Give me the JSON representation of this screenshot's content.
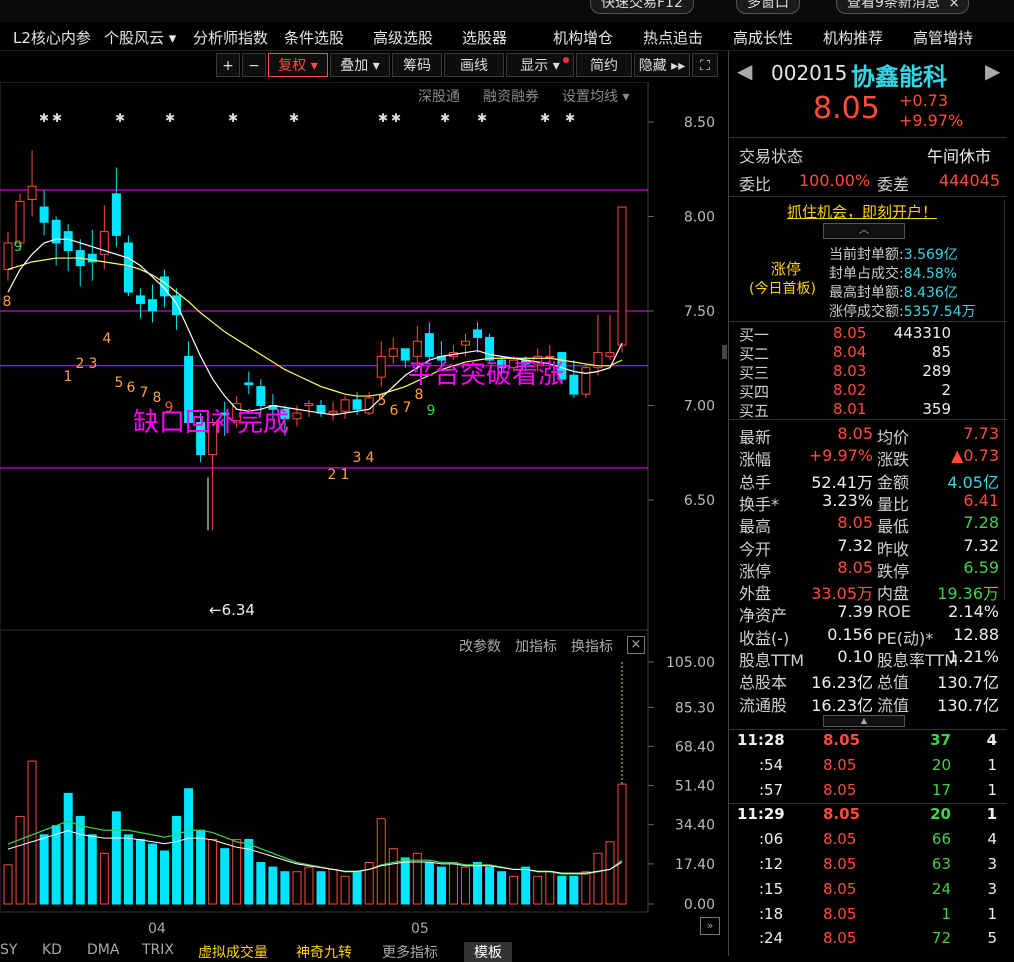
{
  "top": {
    "pill1": "快速交易F12",
    "pill2": "多窗口",
    "pill3": "查看9条新消息",
    "close": "×"
  },
  "nav": [
    "L2核心内参",
    "个股风云 ▾",
    "分析师指数",
    "条件选股",
    "高级选股",
    "选股器",
    "机构增仓",
    "热点追击",
    "高成长性",
    "机构推荐",
    "高管增持"
  ],
  "toolbar": {
    "plus": "+",
    "minus": "−",
    "fuquan": "复权 ▾",
    "diejia": "叠加 ▾",
    "chouma": "筹码",
    "huaxian": "画线",
    "xianshi": "显示 ▾",
    "jianyue": "简约",
    "yincang": "隐藏 ▸▸",
    "expand": "⛶"
  },
  "chart": {
    "sublinks": [
      "深股通",
      "融资融券",
      "设置均线 ▾"
    ],
    "price_ticks": [
      "8.50",
      "8.00",
      "7.50",
      "7.00",
      "6.50"
    ],
    "annotation_gap": "缺口回补完成",
    "annotation_breakout": "平台突破看涨",
    "low_label": "←6.34",
    "vol_links": [
      "改参数",
      "加指标",
      "换指标"
    ],
    "vol_close": "×",
    "vol_ticks": [
      "105.00",
      "85.30",
      "68.40",
      "51.40",
      "34.40",
      "17.40",
      "0.00"
    ],
    "date_labels": [
      "04",
      "05"
    ],
    "seq_labels": [
      {
        "t": "9",
        "c": "#3fd24a"
      },
      {
        "t": "8",
        "c": "#ffa040"
      },
      {
        "t": "1",
        "c": "#ffa040"
      },
      {
        "t": "2",
        "c": "#ffa040"
      },
      {
        "t": "3",
        "c": "#ffa040"
      },
      {
        "t": "4",
        "c": "#ffa040"
      },
      {
        "t": "5",
        "c": "#ffa040"
      },
      {
        "t": "6",
        "c": "#ffa040"
      },
      {
        "t": "7",
        "c": "#ffa040"
      },
      {
        "t": "8",
        "c": "#ffa040"
      },
      {
        "t": "9",
        "c": "#ff4a3d"
      },
      {
        "t": "1",
        "c": "#ffa040"
      },
      {
        "t": "2",
        "c": "#ffa040"
      },
      {
        "t": "3",
        "c": "#ffa040"
      },
      {
        "t": "4",
        "c": "#ffa040"
      },
      {
        "t": "5",
        "c": "#ffa040"
      },
      {
        "t": "6",
        "c": "#ffa040"
      },
      {
        "t": "7",
        "c": "#ffa040"
      },
      {
        "t": "8",
        "c": "#ffa040"
      },
      {
        "t": "9",
        "c": "#3fd24a"
      }
    ]
  },
  "bottom_tabs": [
    "SY",
    "KD",
    "DMA",
    "TRIX",
    "虚拟成交量",
    "神奇九转",
    "更多指标",
    "模板"
  ],
  "stock": {
    "code": "002015",
    "name": "协鑫能科",
    "price": "8.05",
    "change": "+0.73",
    "change_pct": "+9.97%",
    "status_label": "交易状态",
    "status_value": "午间休市",
    "weibi_label": "委比",
    "weibi_value": "100.00%",
    "weicha_label": "委差",
    "weicha_value": "444045",
    "promo": "抓住机会，即刻开户！",
    "limit_title": "涨停",
    "limit_sub": "(今日首板)",
    "limit_rows": [
      {
        "k": "当前封单额:",
        "v": "3.569亿"
      },
      {
        "k": "封单占成交:",
        "v": "84.58%"
      },
      {
        "k": "最高封单额:",
        "v": "8.436亿"
      },
      {
        "k": "涨停成交额:",
        "v": "5357.54万"
      }
    ],
    "bids": [
      {
        "k": "买一",
        "p": "8.05",
        "v": "443310"
      },
      {
        "k": "买二",
        "p": "8.04",
        "v": "85"
      },
      {
        "k": "买三",
        "p": "8.03",
        "v": "289"
      },
      {
        "k": "买四",
        "p": "8.02",
        "v": "2"
      },
      {
        "k": "买五",
        "p": "8.01",
        "v": "359"
      }
    ],
    "stats": [
      {
        "k1": "最新",
        "v1": "8.05",
        "c1": "red",
        "k2": "均价",
        "v2": "7.73",
        "c2": "red"
      },
      {
        "k1": "涨幅",
        "v1": "+9.97%",
        "c1": "red",
        "k2": "涨跌",
        "v2": "▲0.73",
        "c2": "red"
      },
      {
        "k1": "总手",
        "v1": "52.41万",
        "c1": "white",
        "k2": "金额",
        "v2": "4.05亿",
        "c2": "cyan"
      },
      {
        "k1": "换手*",
        "v1": "3.23%",
        "c1": "white",
        "k2": "量比",
        "v2": "6.41",
        "c2": "red"
      },
      {
        "k1": "最高",
        "v1": "8.05",
        "c1": "red",
        "k2": "最低",
        "v2": "7.28",
        "c2": "green"
      },
      {
        "k1": "今开",
        "v1": "7.32",
        "c1": "white",
        "k2": "昨收",
        "v2": "7.32",
        "c2": "white"
      },
      {
        "k1": "涨停",
        "v1": "8.05",
        "c1": "red",
        "k2": "跌停",
        "v2": "6.59",
        "c2": "green"
      },
      {
        "k1": "外盘",
        "v1": "33.05万",
        "c1": "red",
        "k2": "内盘",
        "v2": "19.36万",
        "c2": "green"
      },
      {
        "k1": "净资产",
        "v1": "7.39",
        "c1": "white",
        "k2": "ROE",
        "v2": "2.14%",
        "c2": "white"
      },
      {
        "k1": "收益(-)",
        "v1": "0.156",
        "c1": "white",
        "k2": "PE(动)*",
        "v2": "12.88",
        "c2": "white"
      },
      {
        "k1": "股息TTM",
        "v1": "0.10",
        "c1": "white",
        "k2": "股息率TTM",
        "v2": "1.21%",
        "c2": "white"
      },
      {
        "k1": "总股本",
        "v1": "16.23亿",
        "c1": "white",
        "k2": "总值",
        "v2": "130.7亿",
        "c2": "white"
      },
      {
        "k1": "流通股",
        "v1": "16.23亿",
        "c1": "white",
        "k2": "流值",
        "v2": "130.7亿",
        "c2": "white"
      }
    ],
    "ticks": [
      {
        "t": "11:28",
        "p": "8.05",
        "v": "37",
        "n": "4"
      },
      {
        "t": ":54",
        "p": "8.05",
        "v": "20",
        "n": "1"
      },
      {
        "t": ":57",
        "p": "8.05",
        "v": "17",
        "n": "1"
      },
      {
        "t": "11:29",
        "p": "8.05",
        "v": "20",
        "n": "1"
      },
      {
        "t": ":06",
        "p": "8.05",
        "v": "66",
        "n": "4"
      },
      {
        "t": ":12",
        "p": "8.05",
        "v": "63",
        "n": "3"
      },
      {
        "t": ":15",
        "p": "8.05",
        "v": "24",
        "n": "3"
      },
      {
        "t": ":18",
        "p": "8.05",
        "v": "1",
        "n": "1"
      },
      {
        "t": ":24",
        "p": "8.05",
        "v": "72",
        "n": "5"
      }
    ]
  },
  "colors": {
    "up": "#ff4a3d",
    "down": "#00e5ff",
    "magenta": "#ff00ff",
    "ma5": "#ffffff",
    "ma10": "#ffff66"
  },
  "chart_data": {
    "type": "candlestick",
    "ylim": [
      6.3,
      8.65
    ],
    "horizontal_lines": [
      8.14,
      7.5,
      7.21,
      6.67
    ],
    "low_marker": 6.34,
    "candles": [
      [
        7.72,
        7.86,
        7.66,
        7.92
      ],
      [
        7.86,
        8.08,
        7.82,
        8.12
      ],
      [
        8.09,
        8.16,
        8.0,
        8.35
      ],
      [
        8.05,
        7.97,
        7.9,
        8.14
      ],
      [
        7.98,
        7.86,
        7.74,
        8.0
      ],
      [
        7.92,
        7.82,
        7.71,
        7.96
      ],
      [
        7.82,
        7.74,
        7.63,
        7.88
      ],
      [
        7.8,
        7.76,
        7.66,
        7.93
      ],
      [
        7.8,
        7.92,
        7.72,
        8.06
      ],
      [
        8.12,
        7.9,
        7.84,
        8.26
      ],
      [
        7.86,
        7.6,
        7.58,
        7.9
      ],
      [
        7.58,
        7.54,
        7.46,
        7.62
      ],
      [
        7.56,
        7.5,
        7.44,
        7.64
      ],
      [
        7.68,
        7.58,
        7.52,
        7.72
      ],
      [
        7.58,
        7.48,
        7.4,
        7.62
      ],
      [
        7.26,
        6.91,
        6.88,
        7.34
      ],
      [
        6.91,
        6.74,
        6.7,
        6.96
      ],
      [
        6.74,
        6.91,
        6.34,
        6.93
      ],
      [
        6.96,
        6.95,
        6.84,
        7.02
      ],
      [
        6.92,
        7.01,
        6.88,
        7.05
      ],
      [
        7.12,
        7.11,
        7.06,
        7.18
      ],
      [
        7.1,
        7.0,
        6.96,
        7.14
      ],
      [
        7.0,
        6.98,
        6.92,
        7.06
      ],
      [
        6.98,
        6.93,
        6.84,
        7.0
      ],
      [
        6.93,
        6.96,
        6.89,
        7.0
      ],
      [
        7.0,
        7.01,
        6.94,
        7.03
      ],
      [
        7.0,
        6.96,
        6.94,
        7.03
      ],
      [
        6.96,
        6.97,
        6.92,
        7.02
      ],
      [
        6.97,
        7.03,
        6.93,
        7.05
      ],
      [
        7.03,
        6.98,
        6.95,
        7.07
      ],
      [
        6.96,
        7.04,
        6.95,
        7.07
      ],
      [
        7.15,
        7.26,
        7.1,
        7.34
      ],
      [
        7.26,
        7.3,
        7.22,
        7.36
      ],
      [
        7.3,
        7.24,
        7.2,
        7.3
      ],
      [
        7.26,
        7.34,
        7.18,
        7.42
      ],
      [
        7.38,
        7.26,
        7.24,
        7.44
      ],
      [
        7.26,
        7.24,
        7.2,
        7.34
      ],
      [
        7.26,
        7.28,
        7.24,
        7.32
      ],
      [
        7.32,
        7.34,
        7.26,
        7.38
      ],
      [
        7.4,
        7.36,
        7.28,
        7.44
      ],
      [
        7.36,
        7.24,
        7.22,
        7.38
      ],
      [
        7.24,
        7.2,
        7.16,
        7.26
      ],
      [
        7.2,
        7.24,
        7.18,
        7.26
      ],
      [
        7.24,
        7.22,
        7.18,
        7.26
      ],
      [
        7.22,
        7.26,
        7.18,
        7.3
      ],
      [
        7.26,
        7.26,
        7.22,
        7.32
      ],
      [
        7.28,
        7.14,
        7.12,
        7.28
      ],
      [
        7.16,
        7.06,
        7.04,
        7.24
      ],
      [
        7.06,
        7.2,
        7.04,
        7.22
      ],
      [
        7.2,
        7.28,
        7.16,
        7.48
      ],
      [
        7.26,
        7.28,
        7.24,
        7.48
      ],
      [
        7.32,
        8.05,
        7.28,
        8.05
      ]
    ],
    "ma5": [
      7.6,
      7.72,
      7.8,
      7.86,
      7.88,
      7.88,
      7.86,
      7.84,
      7.82,
      7.8,
      7.78,
      7.74,
      7.68,
      7.62,
      7.54,
      7.4,
      7.26,
      7.14,
      7.05,
      6.98,
      6.97,
      6.98,
      7.0,
      6.99,
      6.98,
      6.97,
      6.96,
      6.95,
      6.96,
      6.97,
      6.98,
      7.04,
      7.1,
      7.16,
      7.2,
      7.24,
      7.26,
      7.27,
      7.28,
      7.29,
      7.27,
      7.26,
      7.25,
      7.24,
      7.23,
      7.22,
      7.2,
      7.18,
      7.17,
      7.18,
      7.2,
      7.33
    ],
    "ma10": [
      7.72,
      7.74,
      7.76,
      7.77,
      7.78,
      7.78,
      7.78,
      7.77,
      7.76,
      7.75,
      7.74,
      7.72,
      7.69,
      7.65,
      7.6,
      7.55,
      7.49,
      7.44,
      7.39,
      7.35,
      7.31,
      7.27,
      7.23,
      7.19,
      7.16,
      7.13,
      7.1,
      7.08,
      7.06,
      7.05,
      7.05,
      7.06,
      7.08,
      7.1,
      7.13,
      7.16,
      7.19,
      7.21,
      7.23,
      7.24,
      7.25,
      7.25,
      7.25,
      7.25,
      7.25,
      7.25,
      7.24,
      7.23,
      7.22,
      7.21,
      7.21,
      7.24
    ],
    "volume_ylim": [
      0,
      105
    ],
    "volume": [
      17,
      38,
      62,
      30,
      34,
      48,
      38,
      30,
      22,
      40,
      30,
      28,
      26,
      23,
      38,
      50,
      32,
      28,
      24,
      28,
      28,
      18,
      16,
      14,
      14,
      16,
      14,
      15,
      12,
      14,
      18,
      37,
      24,
      20,
      22,
      18,
      16,
      18,
      16,
      18,
      16,
      14,
      12,
      16,
      12,
      14,
      12,
      12,
      14,
      22,
      27,
      52
    ],
    "volume_ma": [
      26,
      28,
      30,
      32,
      34,
      36,
      34,
      33,
      32,
      32,
      32,
      31,
      30,
      29,
      30,
      32,
      32,
      31,
      29,
      27,
      26,
      24,
      22,
      20,
      18,
      17,
      16,
      15,
      14,
      14,
      15,
      17,
      18,
      19,
      19,
      19,
      18,
      18,
      17,
      17,
      17,
      16,
      15,
      15,
      14,
      14,
      13,
      13,
      13,
      14,
      15,
      19
    ]
  }
}
